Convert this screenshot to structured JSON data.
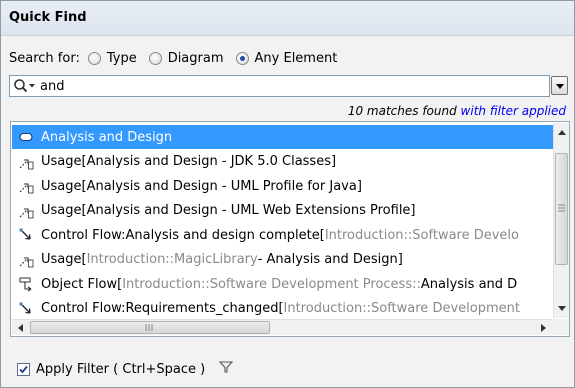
{
  "window": {
    "title": "Quick Find"
  },
  "search": {
    "label": "Search for:",
    "options": [
      {
        "label": "Type",
        "checked": false
      },
      {
        "label": "Diagram",
        "checked": false
      },
      {
        "label": "Any Element",
        "checked": true
      }
    ],
    "query": "and"
  },
  "status": {
    "matches": "10 matches found",
    "filter": "with filter applied"
  },
  "results": [
    {
      "icon": "class-element-icon",
      "parts": [
        {
          "text": "Analysis and Design",
          "gray": false
        }
      ],
      "selected": true
    },
    {
      "icon": "usage-icon",
      "parts": [
        {
          "text": "Usage[Analysis and Design - JDK 5.0 Classes]",
          "gray": false
        }
      ]
    },
    {
      "icon": "usage-icon",
      "parts": [
        {
          "text": "Usage[Analysis and Design - UML Profile for Java]",
          "gray": false
        }
      ]
    },
    {
      "icon": "usage-icon",
      "parts": [
        {
          "text": "Usage[Analysis and Design - UML Web Extensions Profile]",
          "gray": false
        }
      ]
    },
    {
      "icon": "control-flow-icon",
      "parts": [
        {
          "text": "Control Flow:Analysis and design complete[",
          "gray": false
        },
        {
          "text": "Introduction::Software Develo",
          "gray": true
        }
      ]
    },
    {
      "icon": "usage-icon",
      "parts": [
        {
          "text": "Usage[",
          "gray": false
        },
        {
          "text": "Introduction::MagicLibrary",
          "gray": true
        },
        {
          "text": " - Analysis and Design]",
          "gray": false
        }
      ]
    },
    {
      "icon": "object-flow-icon",
      "parts": [
        {
          "text": "Object Flow[",
          "gray": false
        },
        {
          "text": "Introduction::Software Development Process::",
          "gray": true
        },
        {
          "text": "Analysis and D",
          "gray": false
        }
      ]
    },
    {
      "icon": "control-flow-icon",
      "parts": [
        {
          "text": "Control Flow:Requirements_changed[",
          "gray": false
        },
        {
          "text": "Introduction::Software Development",
          "gray": true
        }
      ]
    }
  ],
  "footer": {
    "checkbox_label": "Apply Filter ( Ctrl+Space )",
    "checked": true
  },
  "icons": {
    "filter": "filter-funnel-icon",
    "search": "search-icon"
  },
  "colors": {
    "selection": "#3399ff",
    "link": "#0000ee",
    "qualifier_gray": "#8a8a8a"
  }
}
